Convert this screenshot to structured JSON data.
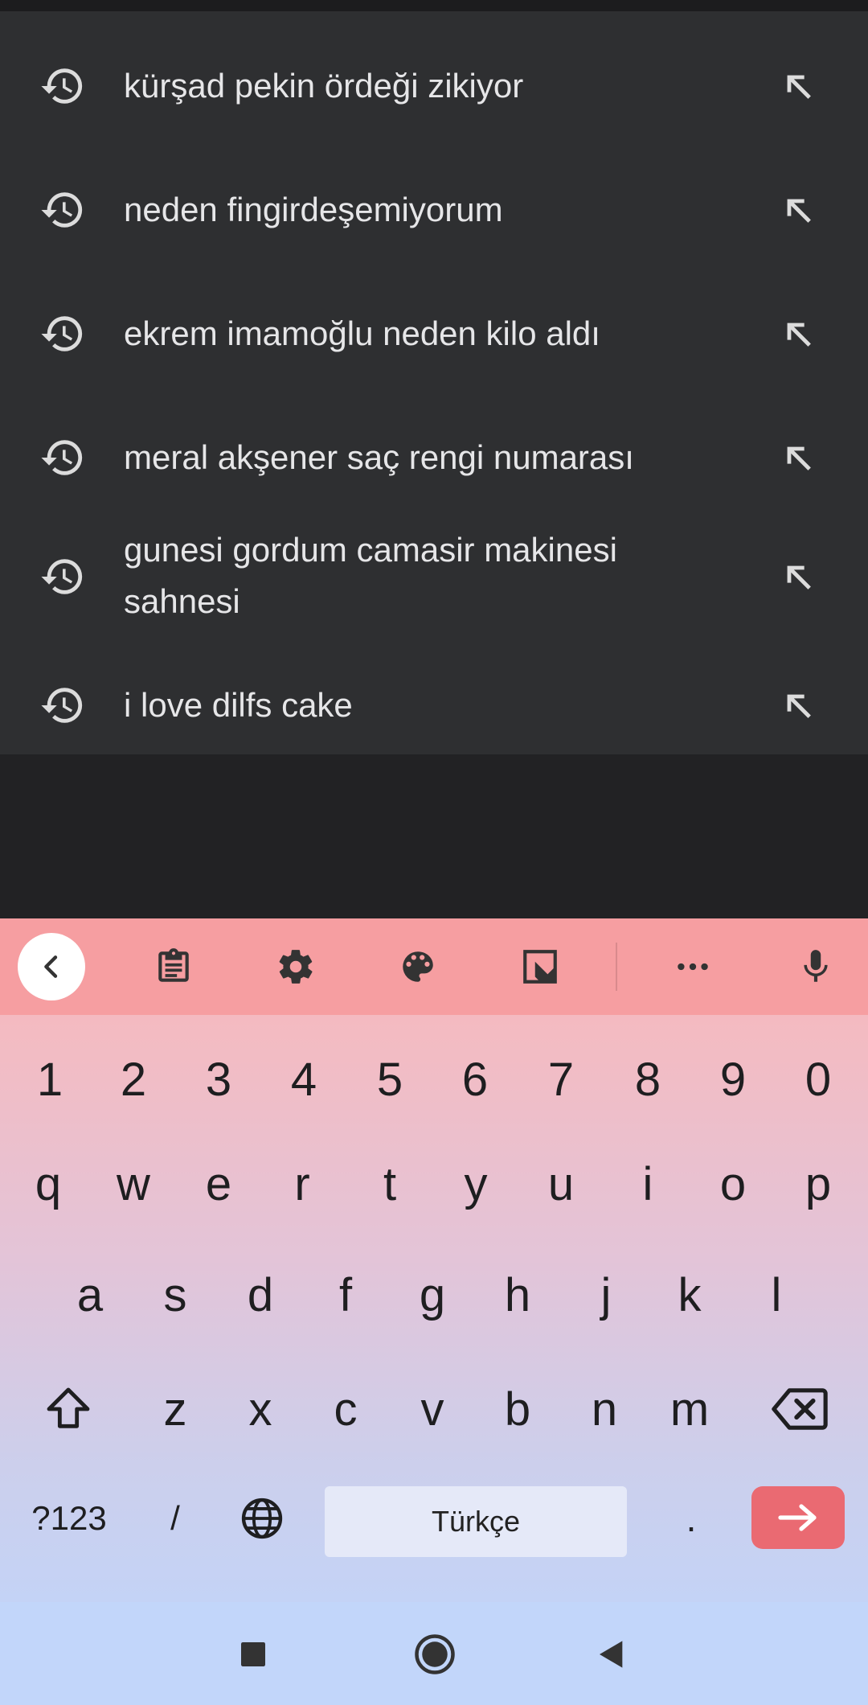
{
  "suggestions": [
    {
      "text": "kürşad pekin ördeği zikiyor"
    },
    {
      "text": "neden fingirdeşemiyorum"
    },
    {
      "text": "ekrem imamoğlu neden kilo aldı"
    },
    {
      "text": "meral akşener saç rengi numarası"
    },
    {
      "text": "gunesi gordum camasir makinesi sahnesi"
    },
    {
      "text": "i love dilfs cake"
    }
  ],
  "keyboard": {
    "toolbar_icons": [
      "back-chevron-icon",
      "clipboard-icon",
      "gear-icon",
      "palette-icon",
      "resize-icon",
      "more-dots-icon",
      "microphone-icon"
    ],
    "number_row": [
      "1",
      "2",
      "3",
      "4",
      "5",
      "6",
      "7",
      "8",
      "9",
      "0"
    ],
    "row1": [
      "q",
      "w",
      "e",
      "r",
      "t",
      "y",
      "u",
      "i",
      "o",
      "p"
    ],
    "row2": [
      "a",
      "s",
      "d",
      "f",
      "g",
      "h",
      "j",
      "k",
      "l"
    ],
    "row3": [
      "z",
      "x",
      "c",
      "v",
      "b",
      "n",
      "m"
    ],
    "symbols_label": "?123",
    "slash_label": "/",
    "space_label": "Türkçe",
    "period_label": ".",
    "enter_color": "#ea6a72",
    "toolbar_color": "#f69ea1"
  },
  "navbar": {
    "icons": [
      "recents-square-icon",
      "home-circle-icon",
      "back-triangle-icon"
    ]
  }
}
